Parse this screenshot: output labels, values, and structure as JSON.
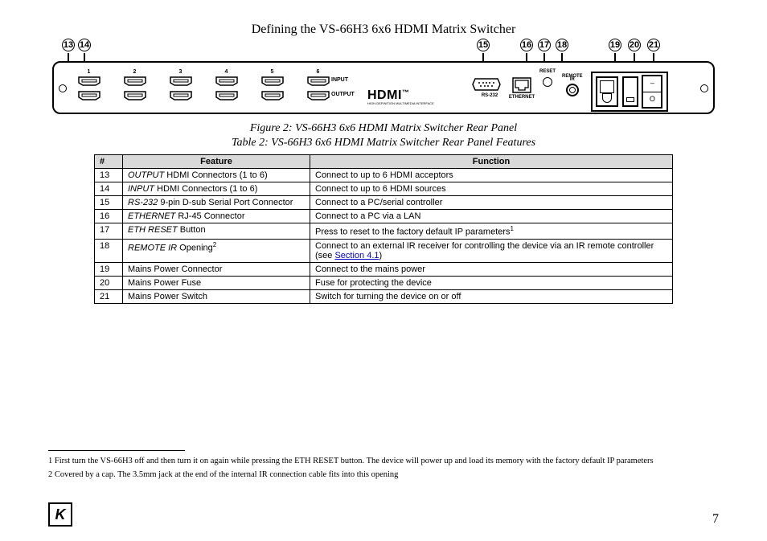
{
  "header": {
    "title": "Defining the VS-66H3 6x6 HDMI Matrix Switcher"
  },
  "callouts": [
    "13",
    "14",
    "15",
    "16",
    "17",
    "18",
    "19",
    "20",
    "21"
  ],
  "panel": {
    "port_numbers": [
      "1",
      "2",
      "3",
      "4",
      "5",
      "6"
    ],
    "input_label": "INPUT",
    "output_label": "OUTPUT",
    "hdmi_logo": "HDMI",
    "hdmi_logo_sub": "HIGH-DEFINITION MULTIMEDIA INTERFACE",
    "rs232_label": "RS-232",
    "ethernet_label": "ETHERNET",
    "reset_label": "RESET",
    "remote_ir_label_1": "REMOTE",
    "remote_ir_label_2": "IR",
    "switch_on": "–",
    "switch_off": "O"
  },
  "captions": {
    "figure": "Figure 2: VS-66H3 6x6 HDMI Matrix Switcher Rear Panel",
    "table": "Table 2: VS-66H3 6x6 HDMI Matrix Switcher Rear Panel Features"
  },
  "table": {
    "headers": [
      "#",
      "Feature",
      "Function"
    ],
    "rows": [
      {
        "n": "13",
        "feat_i": "OUTPUT",
        "feat_r": " HDMI Connectors (1 to 6)",
        "func": "Connect to up to 6 HDMI acceptors"
      },
      {
        "n": "14",
        "feat_i": "INPUT",
        "feat_r": " HDMI Connectors (1 to 6)",
        "func": "Connect to up to 6 HDMI sources"
      },
      {
        "n": "15",
        "feat_i": "RS-232",
        "feat_r": " 9-pin D-sub Serial Port Connector",
        "func": "Connect to a PC/serial controller"
      },
      {
        "n": "16",
        "feat_i": "ETHERNET",
        "feat_r": " RJ-45 Connector",
        "func": "Connect to a PC via a LAN"
      },
      {
        "n": "17",
        "feat_i": "ETH RESET",
        "feat_r": " Button",
        "func": "Press to reset to the factory default IP parameters",
        "func_sup": "1"
      },
      {
        "n": "18",
        "feat_i": "REMOTE IR",
        "feat_r": " Opening",
        "feat_sup": "2",
        "func_pre": "Connect to an external IR receiver for controlling the device via an IR remote controller (see ",
        "func_link": "Section 4.1",
        "func_post": ")"
      },
      {
        "n": "19",
        "feat_r": "Mains Power Connector",
        "func": "Connect to the mains power"
      },
      {
        "n": "20",
        "feat_r": "Mains Power Fuse",
        "func": "Fuse for protecting the device"
      },
      {
        "n": "21",
        "feat_r": "Mains Power Switch",
        "func": "Switch for turning the device on or off"
      }
    ]
  },
  "footnotes": {
    "f1": "1 First turn the VS-66H3 off and then turn it on again while pressing the ETH RESET button. The device will power up and load its memory with the factory default IP parameters",
    "f2": "2 Covered by a cap. The 3.5mm jack at the end of the internal IR connection cable fits into this opening"
  },
  "footer": {
    "logo": "K",
    "page": "7"
  }
}
